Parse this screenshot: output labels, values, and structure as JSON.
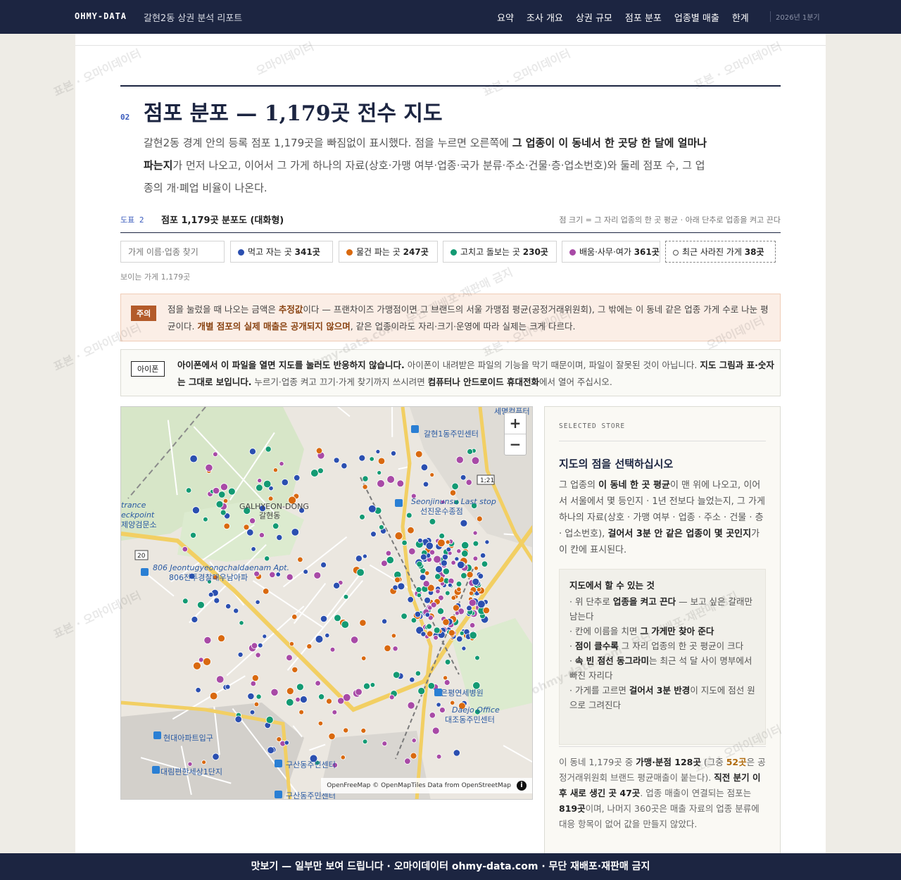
{
  "header": {
    "brand": "OHMY-DATA",
    "report_title": "갈현2동 상권 분석 리포트",
    "nav": [
      "요약",
      "조사 개요",
      "상권 규모",
      "점포 분포",
      "업종별 매출",
      "한계"
    ],
    "period": "2026년 1분기"
  },
  "section": {
    "number": "02",
    "title": "점포 분포 — 1,179곳 전수 지도",
    "lede_1": "갈현2동 경계 안의 등록 점포 1,179곳을 빠짐없이 표시했다. 점을 누르면 오른쪽에 ",
    "lede_b1": "그 업종이 이 동네서 한 곳당 한 달에 얼마나 파는지",
    "lede_2": "가 먼저 나오고, 이어서 그 가게 하나의 자료(상호·가맹 여부·업종·국가 분류·주소·건물·층·업소번호)와 둘레 점포 수, 그 업종의 개·폐업 비율이 나온다."
  },
  "figure": {
    "label": "도표 2",
    "title": "점포 1,179곳 분포도 (대화형)",
    "note": "점 크기 = 그 자리 업종의 한 곳 평균 · 아래 단추로 업종을 켜고 끈다"
  },
  "filters": {
    "search_placeholder": "가게 이름·업종 찾기",
    "chips": [
      {
        "label": "먹고 자는 곳",
        "count": "341곳",
        "color": "#2b4fb0"
      },
      {
        "label": "물건 파는 곳",
        "count": "247곳",
        "color": "#d9690f"
      },
      {
        "label": "고치고 돌보는 곳",
        "count": "230곳",
        "color": "#139a73"
      },
      {
        "label": "배움·사무·여가",
        "count": "361곳",
        "color": "#a84aa6"
      },
      {
        "label": "최근 사라진 가게",
        "count": "38곳",
        "color": "#555555"
      }
    ],
    "visible_count": "보이는 가게 1,179곳"
  },
  "warning": {
    "tag": "주의",
    "t1": "점을 눌렀을 때 나오는 금액은 ",
    "b1": "추정값",
    "t2": "이다 — 프랜차이즈 가맹점이면 그 브랜드의 서울 가맹점 평균(공정거래위원회), 그 밖에는 이 동네 같은 업종 가게 수로 나눈 평균이다. ",
    "b2": "개별 점포의 실제 매출은 공개되지 않으며",
    "t3": ", 같은 업종이라도 자리·크기·운영에 따라 실제는 크게 다르다."
  },
  "iphone": {
    "tag": "아이폰",
    "b1": "아이폰에서 이 파일을 열면 지도를 눌러도 반응하지 않습니다.",
    "t1": " 아이폰이 내려받은 파일의 기능을 막기 때문이며, 파일이 잘못된 것이 아닙니다. ",
    "b2": "지도 그림과 표·숫자는 그대로 보입니다.",
    "t2": " 누르기·업종 켜고 끄기·가게 찾기까지 쓰시려면 ",
    "b3": "컴퓨터나 안드로이드 휴대전화",
    "t3": "에서 열어 주십시오."
  },
  "map": {
    "zoom_in": "+",
    "zoom_out": "−",
    "attribution": "OpenFreeMap © OpenMapTiles Data from OpenStreetMap",
    "info": "i",
    "labels": {
      "galhyeon1": "갈현1동주민센터",
      "seonjin_en": "Seonjinunsu Last stop",
      "seonjin_ko": "선진운수종점",
      "galhyeon_dong_en": "GALHYEON-DONG",
      "galhyeon_dong_ko": "갈현동",
      "apt_en": "806 Jeontugyeongchaldaenam Apt.",
      "apt_ko": "806전투경찰대우남아파",
      "entrance_1": "trance",
      "entrance_2": "eckpoint",
      "entrance_3": "제양검문소",
      "hospital": "은평연세병원",
      "daejo_en": "Daejo Office",
      "daejo_ko": "대조동주민센터",
      "hyundai": "현대아파트입구",
      "daerim": "대림편한세상1단지",
      "gusan1": "구산동주민센터",
      "gusan2": "구산동주민센터",
      "semyeong": "세명컴퓨터",
      "route_121": "1;21",
      "route_20": "20"
    }
  },
  "panel": {
    "kicker": "SELECTED STORE",
    "title": "지도의 점을 선택하십시오",
    "d1": "그 업종의 ",
    "db1": "이 동네 한 곳 평균",
    "d2": "이 맨 위에 나오고, 이어서 서울에서 몇 등인지 · 1년 전보다 늘었는지, 그 가게 하나의 자료(상호 · 가맹 여부 · 업종 · 주소 · 건물 · 층 · 업소번호), ",
    "db2": "걸어서 3분 안 같은 업종이 몇 곳인지",
    "d3": "가 이 칸에 표시된다.",
    "how_title": "지도에서 할 수 있는 것",
    "how_1a": "· 위 단추로 ",
    "how_1b": "업종을 켜고 끈다",
    "how_1c": " — 보고 싶은 갈래만 남는다",
    "how_2a": "· 칸에 이름을 치면 ",
    "how_2b": "그 가게만 찾아 준다",
    "how_3a": "· ",
    "how_3b": "점이 클수록",
    "how_3c": " 그 자리 업종의 한 곳 평균이 크다",
    "how_4a": "· ",
    "how_4b": "속 빈 점선 동그라미",
    "how_4c": "는 최근 석 달 사이 명부에서 빠진 자리다",
    "how_5a": "· 가게를 고르면 ",
    "how_5b": "걸어서 3분 반경",
    "how_5c": "이 지도에 점선 원으로 그려진다",
    "f1": "이 동네 1,179곳 중 ",
    "fb1": "가맹·분점 128곳",
    "f2": " (그중 ",
    "fb2": "52곳",
    "f3": "은 공정거래위원회 브랜드 평균매출이 붙는다). ",
    "fb3": "직전 분기 이후 새로 생긴 곳 47곳",
    "f4": ". 업종 매출이 연결되는 점포는 ",
    "fb4": "819곳",
    "f5": "이며, 나머지 360곳은 매출 자료의 업종 분류에 대응 항목이 없어 값을 만들지 않았다."
  },
  "footer": {
    "text": "맛보기 — 일부만 보여 드립니다 · 오마이데이터 ohmy-data.com · 무단 재배포·재판매 금지"
  },
  "watermark": {
    "a": "표본 · 오마이데이터",
    "b": "ohmy-data.com · 무단 재배포·재판매 금지",
    "c": "오마이데이터"
  }
}
